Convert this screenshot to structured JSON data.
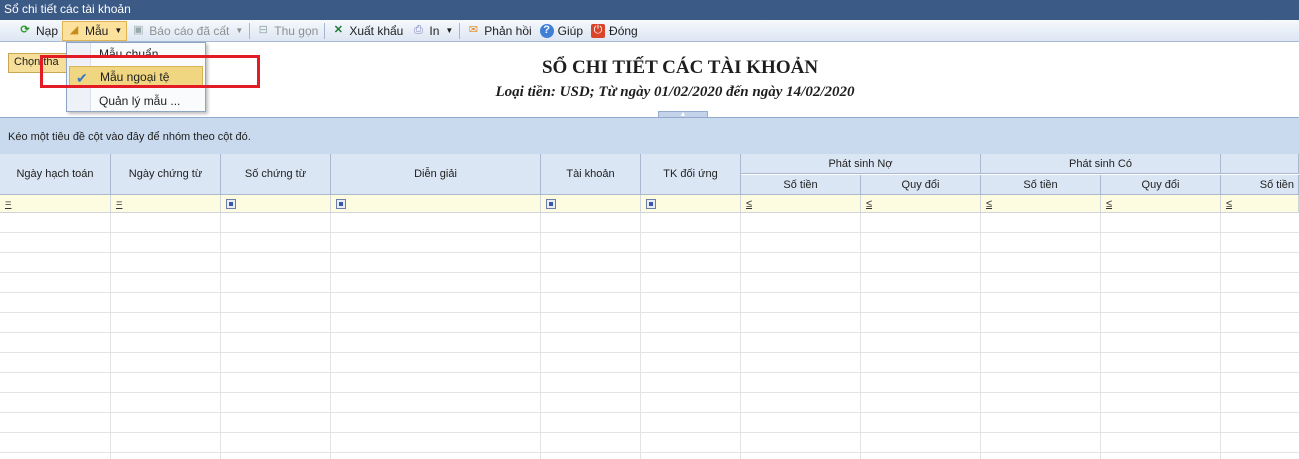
{
  "window": {
    "title": "Sổ chi tiết các tài khoản"
  },
  "toolbar": {
    "items": [
      {
        "label": "Nạp",
        "icon": "refresh-icon",
        "enabled": true
      },
      {
        "label": "Mẫu",
        "icon": "template-icon",
        "enabled": true
      },
      {
        "label": "Báo cáo đã cất",
        "icon": "save-icon",
        "enabled": false
      },
      {
        "label": "Thu gọn",
        "icon": "collapse-icon",
        "enabled": false
      },
      {
        "label": "Xuất khẩu",
        "icon": "excel-icon",
        "enabled": true
      },
      {
        "label": "In",
        "icon": "printer-icon",
        "enabled": true
      },
      {
        "label": "Phản hồi",
        "icon": "mail-icon",
        "enabled": true
      },
      {
        "label": "Giúp",
        "icon": "help-icon",
        "enabled": true
      },
      {
        "label": "Đóng",
        "icon": "power-icon",
        "enabled": true
      }
    ]
  },
  "choose_button": {
    "label": "Chọn tha"
  },
  "template_menu": {
    "items": [
      {
        "label": "Mẫu chuẩn",
        "checked": false
      },
      {
        "label": "Mẫu ngoại tệ",
        "checked": true
      },
      {
        "label": "Quản lý mẫu ..."
      }
    ]
  },
  "report": {
    "title": "SỔ CHI TIẾT CÁC TÀI KHOẢN",
    "subtitle": "Loại tiền: USD; Từ ngày 01/02/2020 đến ngày 14/02/2020"
  },
  "grid": {
    "group_hint": "Kéo một tiêu đề cột vào đây để nhóm theo cột đó.",
    "columns": [
      "Ngày hạch toán",
      "Ngày chứng từ",
      "Số chứng từ",
      "Diễn giải",
      "Tài khoản",
      "TK đối ứng"
    ],
    "group_columns": [
      {
        "label": "Phát sinh Nợ",
        "sub": [
          "Số tiền",
          "Quy đổi"
        ]
      },
      {
        "label": "Phát sinh Có",
        "sub": [
          "Số tiền",
          "Quy đổi"
        ]
      },
      {
        "label": "",
        "sub": [
          "Số tiền"
        ]
      }
    ],
    "filter_ops": [
      "=",
      "=",
      "",
      "",
      "",
      "",
      "≤",
      "≤",
      "≤",
      "≤",
      "≤"
    ]
  },
  "colors": {
    "highlight": "#e21b24",
    "accent": "#f0d680"
  }
}
